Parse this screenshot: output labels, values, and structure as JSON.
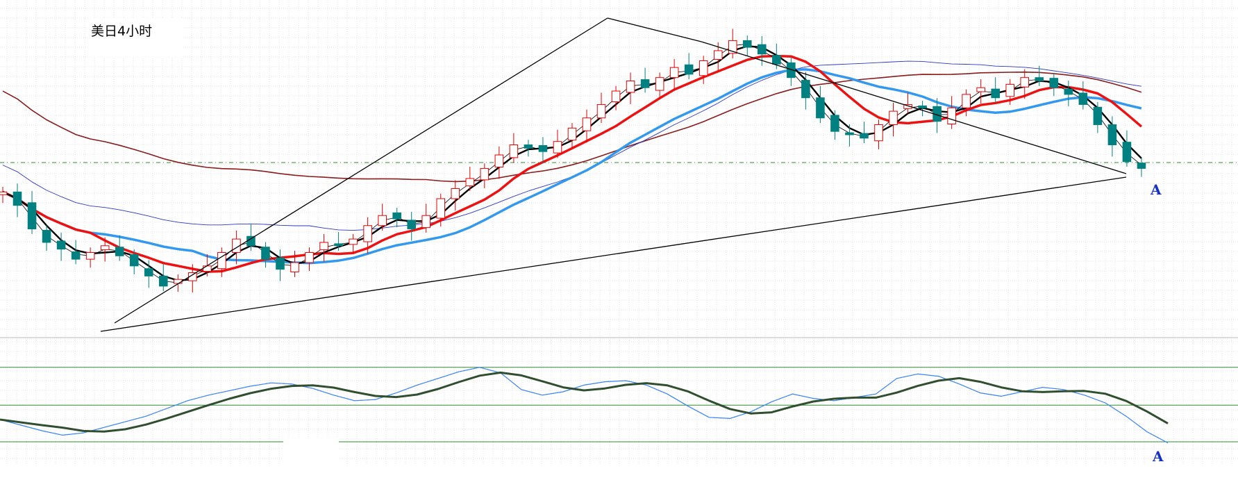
{
  "title": "美日4小时",
  "marker_label": "A",
  "colors": {
    "up": "#e60000",
    "down": "#008080",
    "ma_thin": "#000000",
    "ma_black": "#000000",
    "ma_red": "#ee1111",
    "ma_blue": "#3399ee",
    "ma_navy": "#2a35c8",
    "ma_brown": "#8b1a1a",
    "trend": "#000000",
    "dashed_level": "#2e8b2e",
    "osc_blue": "#3388ff",
    "osc_pink": "#ff3399",
    "osc_dark": "#2f4f2f",
    "osc_level": "#2e8b2e",
    "grid": "#c8c8c8"
  },
  "chart_data": {
    "type": "candlestick",
    "series": [
      {
        "name": "price",
        "values": [
          100,
          96,
          89,
          85,
          83,
          80,
          82,
          84,
          81,
          78,
          75,
          72,
          74,
          76,
          78,
          82,
          86,
          84,
          80,
          77,
          79,
          82,
          85,
          84,
          86,
          90,
          93,
          92,
          89,
          93,
          98,
          101,
          104,
          107,
          111,
          114,
          113,
          112,
          115,
          119,
          122,
          126,
          130,
          133,
          131,
          134,
          137,
          135,
          139,
          142,
          145,
          143,
          141,
          138,
          134,
          128,
          122,
          118,
          117,
          116,
          120,
          124,
          126,
          125,
          121,
          125,
          129,
          131,
          128,
          132,
          134,
          133,
          131,
          129,
          126,
          120,
          114,
          109,
          107
        ]
      }
    ],
    "oscillator": {
      "name": "osc",
      "values": [
        35,
        30,
        25,
        21,
        23,
        28,
        33,
        38,
        45,
        52,
        57,
        61,
        65,
        68,
        67,
        63,
        57,
        52,
        53,
        59,
        66,
        72,
        78,
        82,
        77,
        62,
        57,
        60,
        66,
        69,
        70,
        66,
        58,
        47,
        37,
        36,
        42,
        51,
        58,
        54,
        52,
        55,
        58,
        72,
        76,
        74,
        67,
        59,
        56,
        60,
        64,
        62,
        57,
        50,
        38,
        24,
        14
      ]
    },
    "horizontal_levels_osc": [
      "upper",
      "middle",
      "lower"
    ],
    "grid": true
  }
}
